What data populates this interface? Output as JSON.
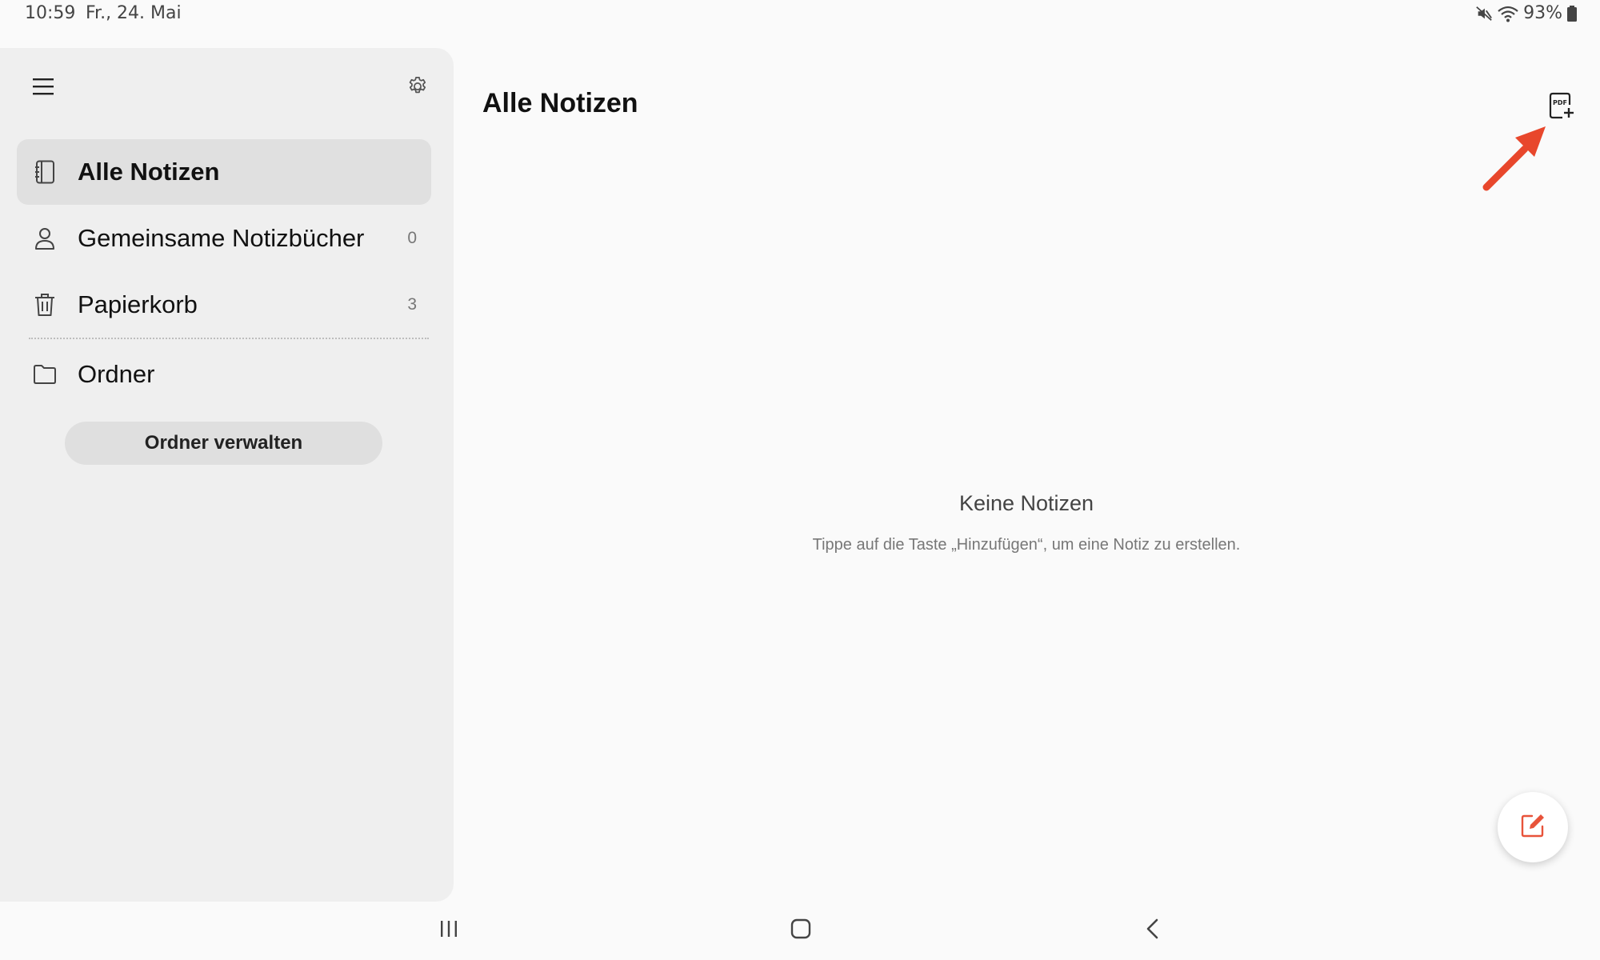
{
  "status": {
    "time": "10:59",
    "date": "Fr., 24. Mai",
    "battery": "93%",
    "icons": [
      "mute-icon",
      "wifi-icon",
      "battery-icon"
    ]
  },
  "sidebar": {
    "items": [
      {
        "label": "Alle Notizen",
        "icon": "notebook-icon",
        "count": "",
        "active": true
      },
      {
        "label": "Gemeinsame Notizbücher",
        "icon": "person-icon",
        "count": "0",
        "active": false
      },
      {
        "label": "Papierkorb",
        "icon": "trash-icon",
        "count": "3",
        "active": false
      },
      {
        "label": "Ordner",
        "icon": "folder-icon",
        "count": "",
        "active": false
      }
    ],
    "manage_button": "Ordner verwalten"
  },
  "main": {
    "title": "Alle Notizen",
    "empty_title": "Keine Notizen",
    "empty_subtitle": "Tippe auf die Taste „Hinzufügen“, um eine Notiz zu erstellen."
  },
  "colors": {
    "accent": "#e8533a",
    "annotation_arrow": "#e8472c",
    "sidebar_bg": "#efefef",
    "active_item_bg": "#e0e0e0"
  }
}
